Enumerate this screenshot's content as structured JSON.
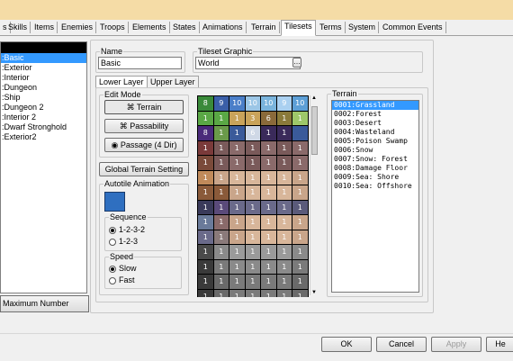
{
  "tabs": [
    "s",
    "Skills",
    "Items",
    "Enemies",
    "Troops",
    "Elements",
    "States",
    "Animations",
    "Terrain",
    "Tilesets",
    "Terms",
    "System",
    "Common Events"
  ],
  "active_tab_index": 9,
  "left_list": {
    "items": [
      ":Basic",
      ":Exterior",
      ":Interior",
      ":Dungeon",
      ":Ship",
      ":Dungeon 2",
      ":Interior 2",
      ":Dwarf Stronghold",
      ":Exterior2"
    ],
    "selected_index": 0,
    "max_button": "Maximum Number"
  },
  "name": {
    "label": "Name",
    "value": "Basic"
  },
  "tileset_graphic": {
    "label": "Tileset Graphic",
    "value": "World"
  },
  "layer_tabs": [
    "Lower Layer",
    "Upper Layer"
  ],
  "edit_mode": {
    "label": "Edit Mode",
    "buttons": [
      "Terrain",
      "Passability",
      "Passage (4 Dir)"
    ]
  },
  "global_terrain_button": "Global Terrain Setting",
  "autotile": {
    "label": "Autotile Animation",
    "sequence_label": "Sequence",
    "sequence_options": [
      "1-2-3-2",
      "1-2-3"
    ],
    "speed_label": "Speed",
    "speed_options": [
      "Slow",
      "Fast"
    ]
  },
  "terrain": {
    "label": "Terrain",
    "items": [
      "0001:Grassland",
      "0002:Forest",
      "0003:Desert",
      "0004:Wasteland",
      "0005:Poison Swamp",
      "0006:Snow",
      "0007:Snow: Forest",
      "0008:Damage Floor",
      "0009:Sea: Shore",
      "0010:Sea: Offshore"
    ],
    "selected_index": 0
  },
  "tiles": [
    "8",
    "9",
    "10",
    "10",
    "10",
    "9",
    "10",
    "1",
    "1",
    "1",
    "3",
    "6",
    "1",
    "1",
    "8",
    "1",
    "1",
    "6",
    "1",
    "1",
    "",
    "1",
    "1",
    "1",
    "1",
    "1",
    "1",
    "1",
    "1",
    "1",
    "1",
    "1",
    "1",
    "1",
    "1",
    "1",
    "1",
    "1",
    "1",
    "1",
    "1",
    "1",
    "1",
    "1",
    "1",
    "1",
    "1",
    "1",
    "1",
    "1",
    "1",
    "1",
    "1",
    "1",
    "1",
    "1",
    "1",
    "1",
    "1",
    "1",
    "1",
    "1",
    "1",
    "1",
    "1",
    "1",
    "1",
    "1",
    "1",
    "1",
    "1",
    "1",
    "1",
    "1",
    "1",
    "1",
    "1",
    "1",
    "1",
    "1",
    "1",
    "1",
    "1",
    "1",
    "1",
    "1",
    "1",
    "1",
    "1",
    "1",
    "1",
    "1",
    "1",
    "1",
    "1",
    "1",
    "1",
    "1"
  ],
  "tile_colors": [
    "#3a8a3a",
    "#3b5fa8",
    "#4a7ec8",
    "#9cc6e6",
    "#7ab4dc",
    "#aad0f0",
    "#5d9fd6",
    "#5aa845",
    "#5aa845",
    "#c9a35a",
    "#c9a35a",
    "#8a6a3a",
    "#8a7a3a",
    "#9ec86a",
    "#4a2a7a",
    "#6a9a4a",
    "#3a5a9a",
    "#cfd8e6",
    "#3a2a5a",
    "#3a2a5a",
    "#3a5a9a",
    "#7a3a3a",
    "#7a5a5a",
    "#8a6a6a",
    "#7a5a5a",
    "#8a6a6a",
    "#7a5a5a",
    "#8a6a6a",
    "#7a4a3a",
    "#7a5a5a",
    "#8a6a6a",
    "#7a5a5a",
    "#8a6a6a",
    "#7a5a5a",
    "#8a6a6a",
    "#c08a5a",
    "#c9a58a",
    "#d8b69a",
    "#d8b69a",
    "#d8b69a",
    "#d8b69a",
    "#c9a58a",
    "#8a5a3a",
    "#8a5a3a",
    "#c9a58a",
    "#d8b69a",
    "#d8b69a",
    "#d8b69a",
    "#c9a58a",
    "#3a3a5a",
    "#5a4a7a",
    "#6a6a8a",
    "#6a6a8a",
    "#6a6a8a",
    "#6a6a8a",
    "#5a5a7a",
    "#6a7a9a",
    "#8a6a6a",
    "#c9a58a",
    "#d8b69a",
    "#d8b69a",
    "#d8b69a",
    "#c9a58a",
    "#6a6a8a",
    "#8a7a7a",
    "#c9a58a",
    "#d8b69a",
    "#d8b69a",
    "#d8b69a",
    "#c9a58a",
    "#4a4a4a",
    "#8a8a8a",
    "#9a9a9a",
    "#9a9a9a",
    "#9a9a9a",
    "#9a9a9a",
    "#8a8a8a",
    "#3a3a3a",
    "#7a7a7a",
    "#8a8a8a",
    "#8a8a8a",
    "#8a8a8a",
    "#8a8a8a",
    "#7a7a7a",
    "#3a3a3a",
    "#6a6a6a",
    "#7a7a7a",
    "#7a7a7a",
    "#7a7a7a",
    "#7a7a7a",
    "#6a6a6a",
    "#3a3a3a",
    "#6a6a6a",
    "#7a7a7a",
    "#7a7a7a",
    "#7a7a7a",
    "#7a7a7a",
    "#6a6a6a"
  ],
  "bottom_buttons": [
    "OK",
    "Cancel",
    "Apply",
    "He"
  ]
}
